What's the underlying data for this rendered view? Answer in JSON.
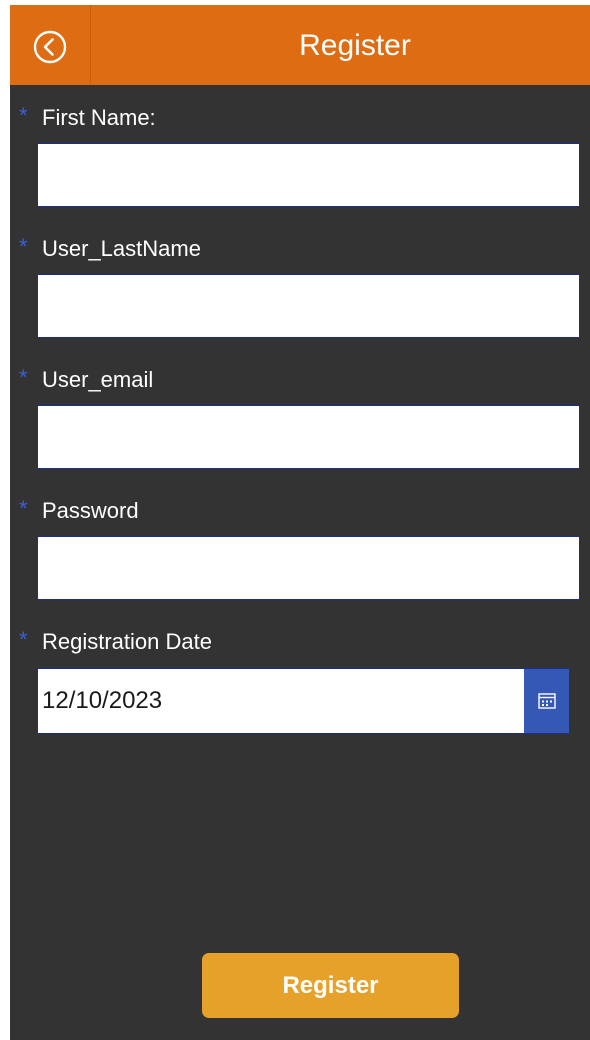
{
  "header": {
    "title": "Register"
  },
  "form": {
    "fields": [
      {
        "label": "First Name:",
        "value": ""
      },
      {
        "label": "User_LastName",
        "value": ""
      },
      {
        "label": "User_email",
        "value": ""
      },
      {
        "label": "Password",
        "value": ""
      }
    ],
    "date": {
      "label": "Registration Date",
      "value": "12/10/2023"
    },
    "required_marker": "*",
    "submit_label": "Register"
  },
  "colors": {
    "header_bg": "#de6c12",
    "body_bg": "#333333",
    "accent_blue": "#3558b5",
    "button_bg": "#e6a12b"
  },
  "icons": {
    "back": "chevron-left-circle-icon",
    "calendar": "calendar-icon"
  }
}
